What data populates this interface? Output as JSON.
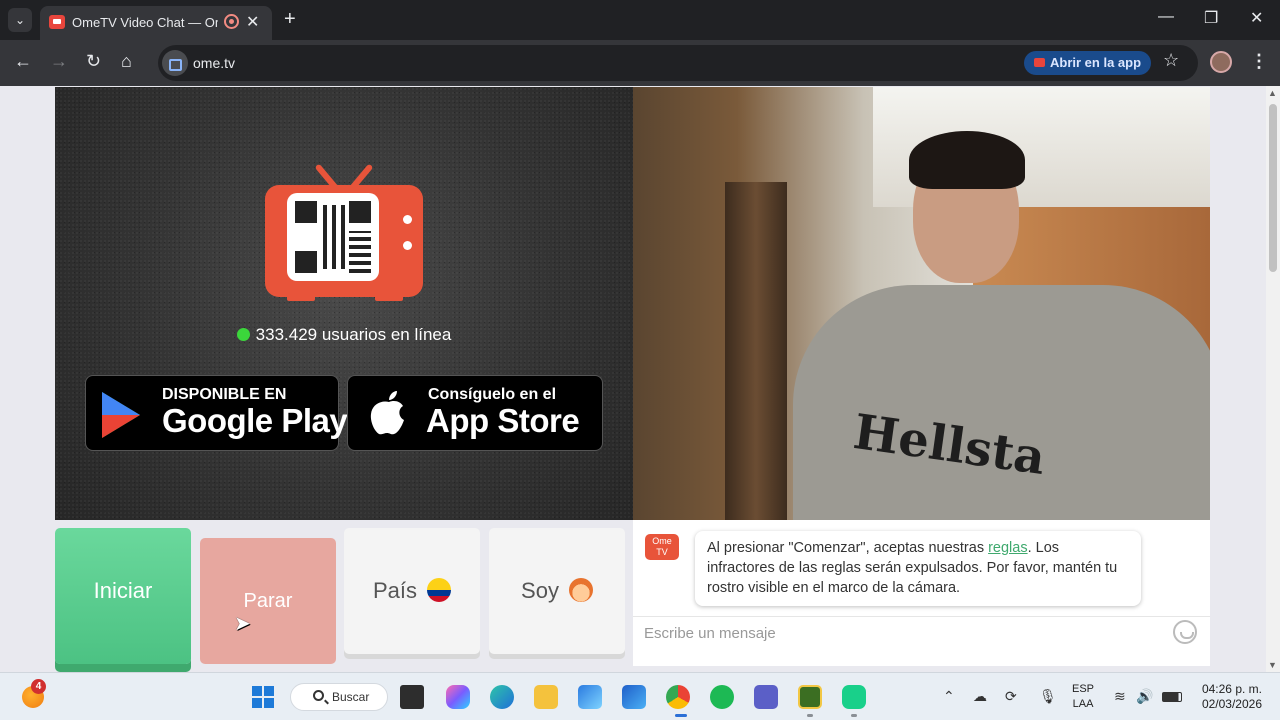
{
  "browser": {
    "tab_title": "OmeTV Video Chat — Omegle",
    "url": "ome.tv",
    "open_in_app": "Abrir en la app",
    "tab_close": "✕",
    "new_tab": "+",
    "minimize": "—",
    "restore": "❐",
    "close": "✕",
    "back": "←",
    "forward": "→",
    "reload": "↻",
    "home": "⌂",
    "bookmark": "☆",
    "menu": "⋮",
    "tab_list": "⌄"
  },
  "left_panel": {
    "online_count": "333.429 usuarios en línea",
    "google_play": {
      "small": "DISPONIBLE EN",
      "big": "Google Play"
    },
    "app_store": {
      "small": "Consíguelo en el",
      "big": "App Store"
    }
  },
  "right_panel": {
    "shirt_print": "Hellsta"
  },
  "controls": {
    "start": "Iniciar",
    "stop": "Parar",
    "country": "País",
    "gender": "Soy"
  },
  "chat": {
    "logo_line1": "Ome",
    "logo_line2": "TV",
    "message_before": "Al presionar \"Comenzar\", aceptas nuestras ",
    "message_link": "reglas",
    "message_after": ". Los infractores de las reglas serán expulsados. Por favor, mantén tu rostro visible en el marco de la cámara.",
    "input_placeholder": "Escribe un mensaje"
  },
  "taskbar": {
    "weather_badge": "4",
    "search_label": "Buscar",
    "lang_line1": "ESP",
    "lang_line2": "LAA",
    "time": "04:26 p. m.",
    "date": "02/03/2026"
  },
  "colors": {
    "brand_red": "#e8543a",
    "start_green": "#4cc283",
    "online_green": "#3bd63b",
    "link_green": "#3fa96e"
  }
}
